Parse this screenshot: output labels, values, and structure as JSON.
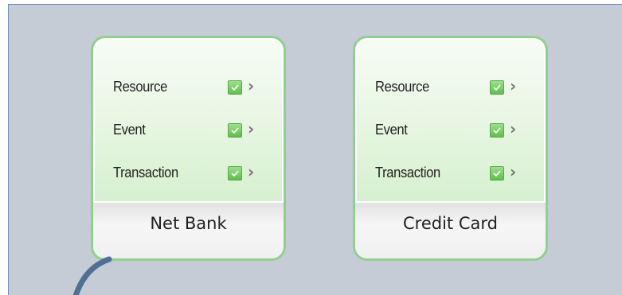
{
  "cards": [
    {
      "name": "Net Bank",
      "rows": [
        {
          "label": "Resource",
          "checked": true,
          "arrow": "›"
        },
        {
          "label": "Event",
          "checked": true,
          "arrow": "›"
        },
        {
          "label": "Transaction",
          "checked": true,
          "arrow": "›"
        }
      ]
    },
    {
      "name": "Credit Card",
      "rows": [
        {
          "label": "Resource",
          "checked": true,
          "arrow": "›"
        },
        {
          "label": "Event",
          "checked": true,
          "arrow": "›"
        },
        {
          "label": "Transaction",
          "checked": true,
          "arrow": "›"
        }
      ]
    }
  ],
  "colors": {
    "canvas": "#c5ccd5",
    "card_border": "#8fd08f",
    "checkbox": "#6cc659",
    "connector": "#4f6f95"
  }
}
